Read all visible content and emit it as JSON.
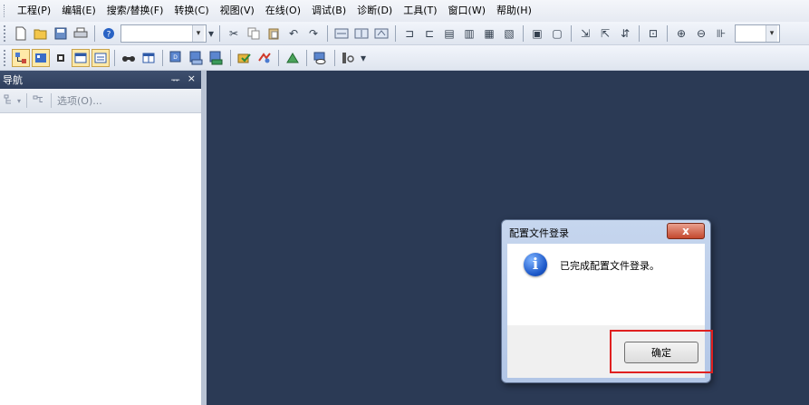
{
  "menu": {
    "items": [
      "工程(P)",
      "编辑(E)",
      "搜索/替换(F)",
      "转换(C)",
      "视图(V)",
      "在线(O)",
      "调试(B)",
      "诊断(D)",
      "工具(T)",
      "窗口(W)",
      "帮助(H)"
    ]
  },
  "toolbar1": {
    "icons": [
      "new-icon",
      "open-icon",
      "save-icon",
      "print-icon",
      "help-icon",
      "cut-icon",
      "copy-icon",
      "paste-icon",
      "undo-icon",
      "redo-icon",
      "zoom-in-icon",
      "zoom-out-icon"
    ],
    "combo_value": "",
    "zoom_value": ""
  },
  "navigation": {
    "title": "导航",
    "pin_glyph": "ᅲ",
    "close_glyph": "×",
    "options_label": "选项(O)..."
  },
  "dialog": {
    "title": "配置文件登录",
    "close_label": "x",
    "message": "已完成配置文件登录。",
    "ok_label": "确定",
    "info_glyph": "i"
  },
  "colors": {
    "workspace": "#2b3a55",
    "highlight": "#e02020"
  }
}
